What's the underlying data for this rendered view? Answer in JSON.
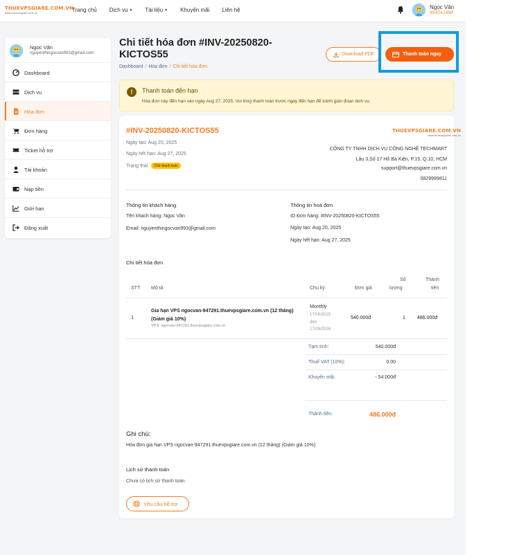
{
  "header": {
    "logo_text": "THUEVPSGIARE.COM.VN",
    "logo_tagline": "www.thuevpsgiare.com.vn",
    "nav": [
      {
        "label": "Trang chủ",
        "dropdown": false
      },
      {
        "label": "Dịch vụ",
        "dropdown": true
      },
      {
        "label": "Tài liệu",
        "dropdown": true
      },
      {
        "label": "Khuyến mãi",
        "dropdown": false
      },
      {
        "label": "Liên hệ",
        "dropdown": false
      }
    ],
    "user_name": "Ngọc Vân",
    "user_balance": "99.674.189đ",
    "bell_icon": "bell-icon"
  },
  "sidebar": {
    "user_name": "Ngọc Vân",
    "user_email": "nguyenthingocvan993@gmail.com",
    "items": [
      {
        "label": "Dashboard",
        "icon": "dashboard-icon",
        "active": false
      },
      {
        "label": "Dịch vụ",
        "icon": "server-icon",
        "active": false
      },
      {
        "label": "Hóa đơn",
        "icon": "invoice-icon",
        "active": true
      },
      {
        "label": "Đơn hàng",
        "icon": "cart-icon",
        "active": false
      },
      {
        "label": "Ticket hỗ trợ",
        "icon": "ticket-icon",
        "active": false
      },
      {
        "label": "Tài khoản",
        "icon": "user-icon",
        "active": false
      },
      {
        "label": "Nạp tiền",
        "icon": "wallet-icon",
        "active": false
      },
      {
        "label": "Giới hạn",
        "icon": "chart-icon",
        "active": false
      },
      {
        "label": "Đăng xuất",
        "icon": "logout-icon",
        "active": false
      }
    ]
  },
  "page": {
    "title": "Chi tiết hóa đơn #INV-20250820-KICTOS55",
    "breadcrumb": [
      "Dashboard",
      "Hóa đơn",
      "Chi tiết hóa đơn"
    ],
    "download_label": "Download PDF",
    "pay_label": "Thanh toán ngay"
  },
  "alert": {
    "title": "Thanh toán đến hạn",
    "text": "Hóa đơn này đến hạn vào ngày Aug 27, 2025. Vui lòng thanh toán trước ngày đến hạn để tránh gián đoạn dịch vụ."
  },
  "invoice": {
    "code": "#INV-20250820-KICTOS55",
    "created": "Ngày tạo: Aug 20, 2025",
    "due": "Ngày hết hạn: Aug 27, 2025",
    "status_label": "Trạng thái:",
    "status_badge": "Chờ thanh toán"
  },
  "company": {
    "logo_text": "THUEVPSGIARE.COM.VN",
    "logo_tagline": "www.thuevpsgiare.com.vn",
    "name": "CÔNG TY TNHH DỊCH VỤ CÔNG NGHỆ TECHMART",
    "address": "Lầu 3,Số 17 Hồ Bá Kiện, P.15, Q.10, HCM",
    "email": "support@thuevpsgiare.com.vn",
    "phone": "0829999811"
  },
  "customer": {
    "section_title": "Thông tin khách hàng",
    "name": "Tên khách hàng: Ngọc Vân",
    "email": "Email: nguyenthingocvan993@gmail.com"
  },
  "invoice_info": {
    "section_title": "Thông tin hoá đơn",
    "order_id": "ID Đơn hàng: #INV-20250820-KICTOS55",
    "created": "Ngày tạo: Aug 20, 2025",
    "due": "Ngày hết hạn: Aug 27, 2025"
  },
  "items_table": {
    "section_title": "Chi tiết hóa đơn",
    "headers": {
      "stt": "STT",
      "desc": "Mô tả",
      "period": "Chu kỳ",
      "price": "Đơn giá",
      "qty_1": "Số",
      "qty_2": "lượng",
      "total_1": "Thành",
      "total_2": "tiền"
    },
    "rows": [
      {
        "stt": "1",
        "title": "Gia hạn VPS ngocvan-947291.thuevpsgiare.com.vn (12 tháng) (Giảm giá 10%)",
        "sub": "VPS: ngocvan-947291.thuevpsgiare.com.vn",
        "period": "Monthly",
        "period_from": "17/09/2025",
        "period_to_label": "đến",
        "period_to": "17/09/2026",
        "price": "540.000đ",
        "qty": "1",
        "total": "486.000đ"
      }
    ]
  },
  "summary": {
    "subtotal_label": "Tạm tính:",
    "subtotal": "540.000đ",
    "vat_label": "Thuế VAT (10%):",
    "vat": "0.00",
    "discount_label": "Khuyến mãi:",
    "discount": "- 54.000đ",
    "total_label": "Thành tiền:",
    "total": "486.000đ"
  },
  "notes": {
    "title": "Ghi chú:",
    "text": "Hóa đơn gia hạn VPS ngocvan-947291.thuevpsgiare.com.vn (12 tháng) (Giảm giá 10%)"
  },
  "history": {
    "title": "Lịch sử thanh toán",
    "text": "Chưa có lịch sử thanh toán."
  },
  "support_button": "Yêu cầu hỗ trợ",
  "colors": {
    "accent": "#f47c20",
    "pay_button": "#f35f0f",
    "highlight": "#0f9ddb",
    "alert_bg": "#fff6d6",
    "badge": "#ffc107"
  }
}
